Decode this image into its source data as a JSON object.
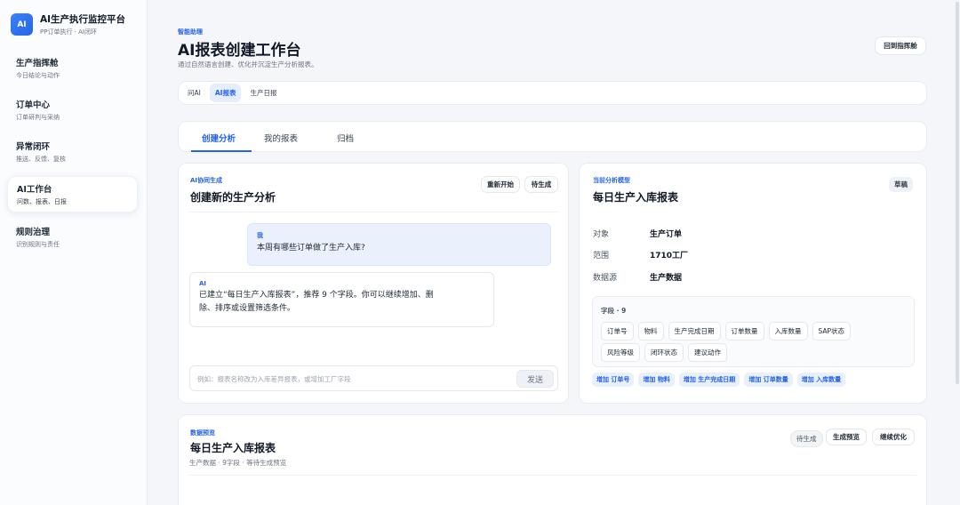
{
  "brand": {
    "logo": "AI",
    "title": "AI生产执行监控平台",
    "subtitle": "PP订单执行 · AI闭环"
  },
  "sidebar": {
    "items": [
      {
        "title": "生产指挥舱",
        "sub": "今日结论与动作"
      },
      {
        "title": "订单中心",
        "sub": "订单研判与采纳"
      },
      {
        "title": "异常闭环",
        "sub": "推送、反馈、复核"
      },
      {
        "title": "AI工作台",
        "sub": "问数、报表、日报"
      },
      {
        "title": "规则治理",
        "sub": "识别规则与责任"
      }
    ],
    "active_index": 3
  },
  "header": {
    "eyebrow": "智能助理",
    "title": "AI报表创建工作台",
    "desc": "通过自然语言创建、优化并沉淀生产分析报表。",
    "home_button": "回到指挥舱"
  },
  "subtabs": [
    "问AI",
    "AI报表",
    "生产日报"
  ],
  "subtab_active": 1,
  "tabs": [
    "创建分析",
    "我的报表",
    "归档"
  ],
  "tab_active": 0,
  "chat": {
    "eyebrow": "AI协同生成",
    "title": "创建新的生产分析",
    "restart_button": "重新开始",
    "status_button": "待生成",
    "user_label": "我",
    "user_message": "本周有哪些订单做了生产入库?",
    "ai_label": "AI",
    "ai_message_line1": "已建立“每日生产入库报表”，推荐 9 个字段。你可以继续增加、删",
    "ai_message_line2": "除、排序或设置筛选条件。",
    "input_placeholder": "例如：报表名称改为入库差异报表，或增加工厂字段",
    "send_button": "发送"
  },
  "model": {
    "eyebrow": "当前分析模型",
    "title": "每日生产入库报表",
    "draft_badge": "草稿",
    "rows": [
      {
        "k": "对象",
        "v": "生产订单"
      },
      {
        "k": "范围",
        "v": "1710工厂"
      },
      {
        "k": "数据源",
        "v": "生产数据"
      }
    ],
    "fields_label": "字段 · 9",
    "fields_row1": [
      "订单号",
      "物料",
      "生产完成日期",
      "订单数量",
      "入库数量",
      "SAP状态"
    ],
    "fields_row2": [
      "风险等级",
      "闭环状态",
      "建议动作"
    ],
    "add_chips": [
      "增加 订单号",
      "增加 物料",
      "增加 生产完成日期",
      "增加 订单数量",
      "增加 入库数量"
    ]
  },
  "preview": {
    "eyebrow": "数据预览",
    "title": "每日生产入库报表",
    "sub": "生产数据 · 9字段 · 等待生成预览",
    "status": "待生成",
    "generate_button": "生成预览",
    "optimize_button": "继续优化"
  }
}
